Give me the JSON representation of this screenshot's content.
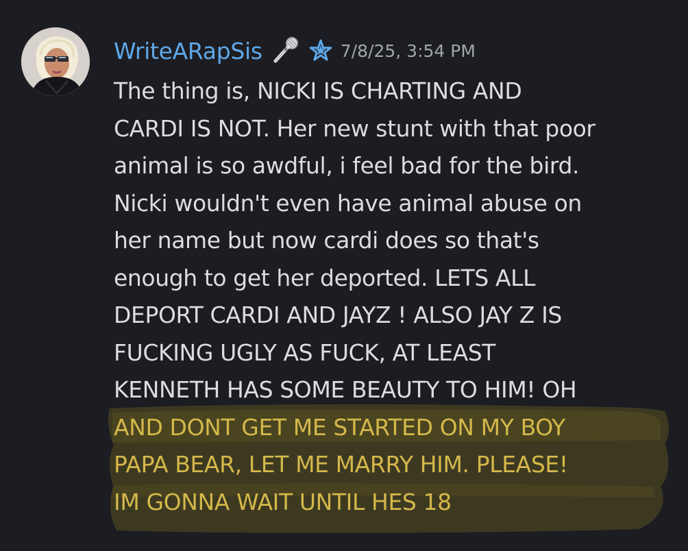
{
  "message": {
    "author": "WriteARapSis",
    "timestamp": "7/8/25, 3:54 PM",
    "badges": {
      "first": "microphone-icon",
      "second": "star-icon"
    },
    "colors": {
      "background": "#1c1d22",
      "username": "#5fa8e8",
      "text": "#dcdde0",
      "timestamp": "#a2a5ac",
      "highlight": "#b8a11e",
      "highlighted_text": "#d4b84a"
    },
    "lines": [
      "The thing is, NICKI IS CHARTING AND",
      "CARDI IS NOT. Her new stunt with that poor",
      "animal is so awdful, i feel bad for the bird.",
      "Nicki wouldn't even have animal abuse on",
      "her name but now cardi does so that's",
      "enough to get her deported. LETS ALL",
      "DEPORT CARDI AND JAYZ ! ALSO JAY Z IS",
      "FUCKING UGLY AS FUCK, AT LEAST",
      "KENNETH HAS SOME BEAUTY TO HIM! OH",
      "AND DONT GET ME STARTED ON MY BOY",
      "PAPA BEAR, LET ME MARRY HIM. PLEASE!",
      "IM GONNA WAIT UNTIL HES 18"
    ]
  }
}
